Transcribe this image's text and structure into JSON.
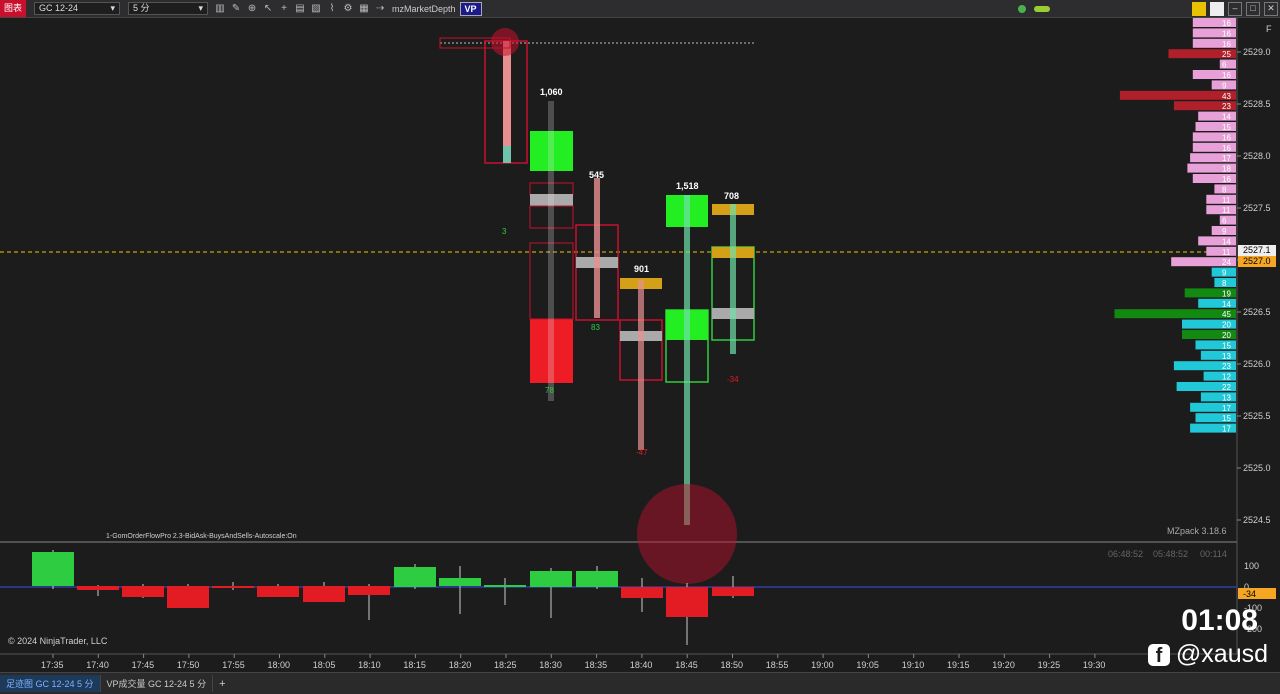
{
  "toolbar": {
    "chart_label": "图表",
    "instrument": "GC 12-24",
    "interval": "5 分",
    "indicator_text": "mzMarketDepth",
    "vp_label": "VP"
  },
  "price_axis": {
    "labels": [
      "2529.0",
      "2528.5",
      "2528.0",
      "2527.5",
      "2527.0",
      "2526.5",
      "2526.0",
      "2525.5",
      "2525.0",
      "2524.5"
    ],
    "current_price": "2527.1",
    "current_price_alt": "2527.0",
    "f_label": "F"
  },
  "time_axis": {
    "labels": [
      "17:35",
      "17:40",
      "17:45",
      "17:50",
      "17:55",
      "18:00",
      "18:05",
      "18:10",
      "18:15",
      "18:20",
      "18:25",
      "18:30",
      "18:35",
      "18:40",
      "18:45",
      "18:50",
      "18:55",
      "19:00",
      "19:05",
      "19:10",
      "19:15",
      "19:20",
      "19:25",
      "19:30"
    ]
  },
  "indicator_label": "1-GomOrderFlowPro 2.3-BidAsk-BuysAndSells-Autoscale:On",
  "mzpack_label": "MZpack 3.18.6",
  "footprint": {
    "bar_totals": [
      "1,060",
      "545",
      "901",
      "1,518",
      "708"
    ],
    "deltas": [
      "3",
      "78",
      "83",
      "-47",
      "-34"
    ]
  },
  "volume_profile": {
    "values": [
      "16",
      "16",
      "16",
      "25",
      "6",
      "16",
      "9",
      "43",
      "23",
      "14",
      "15",
      "16",
      "16",
      "17",
      "18",
      "16",
      "8",
      "11",
      "11",
      "6",
      "9",
      "14",
      "11",
      "24",
      "9",
      "8",
      "19",
      "14",
      "45",
      "20",
      "20",
      "15",
      "13",
      "23",
      "12",
      "22",
      "13",
      "17",
      "15",
      "17"
    ]
  },
  "lower_panel": {
    "axis_labels": [
      "100",
      "0",
      "-100",
      "-200"
    ],
    "current_value": "-34",
    "timestamps": [
      "06:48:52",
      "05:48:52",
      "00:114"
    ],
    "copyright": "© 2024 NinjaTrader, LLC"
  },
  "tabs": [
    {
      "label": "足迹图 GC 12-24 5 分"
    },
    {
      "label": "VP成交量 GC 12-24 5 分"
    }
  ],
  "overlay": {
    "clock": "01:08",
    "handle": "@xausd"
  },
  "colors": {
    "background": "#1c1c1c",
    "bull": "#2ecc40",
    "bear": "#e31b23",
    "cyan": "#20c8d8",
    "pink": "#e8a0d8",
    "price_line": "#f5c400"
  }
}
